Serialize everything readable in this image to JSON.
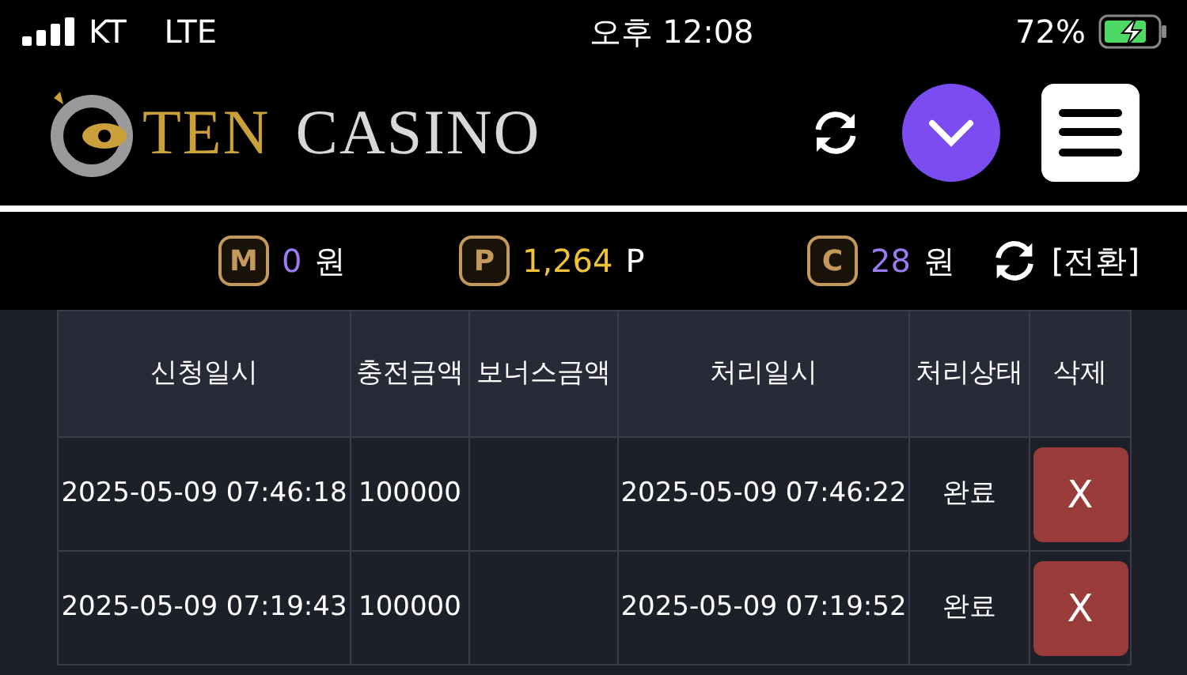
{
  "status_bar": {
    "carrier": "KT",
    "network": "LTE",
    "time": "오후 12:08",
    "battery": "72%"
  },
  "header": {
    "logo": [
      {
        "text": "TEN",
        "kind": "gold"
      },
      {
        "text": "CASINO",
        "kind": "silver"
      }
    ]
  },
  "balances": [
    {
      "badge": "M",
      "amount": "0",
      "unit": "원",
      "color": "#9b7cf0"
    },
    {
      "badge": "P",
      "amount": "1,264",
      "unit": "P",
      "color": "#f0c23a"
    },
    {
      "badge": "C",
      "amount": "28",
      "unit": "원",
      "color": "#9b7cf0"
    }
  ],
  "switch_label": "[전환]",
  "table": {
    "columns": [
      "신청일시",
      "충전금액",
      "보너스금액",
      "처리일시",
      "처리상태",
      "삭제"
    ],
    "rows": [
      {
        "requested": "2025-05-09 07:46:18",
        "amount": "100000",
        "bonus": "",
        "processed": "2025-05-09 07:46:22",
        "status": "완료",
        "delete": "X"
      },
      {
        "requested": "2025-05-09 07:19:43",
        "amount": "100000",
        "bonus": "",
        "processed": "2025-05-09 07:19:52",
        "status": "완료",
        "delete": "X"
      }
    ]
  }
}
